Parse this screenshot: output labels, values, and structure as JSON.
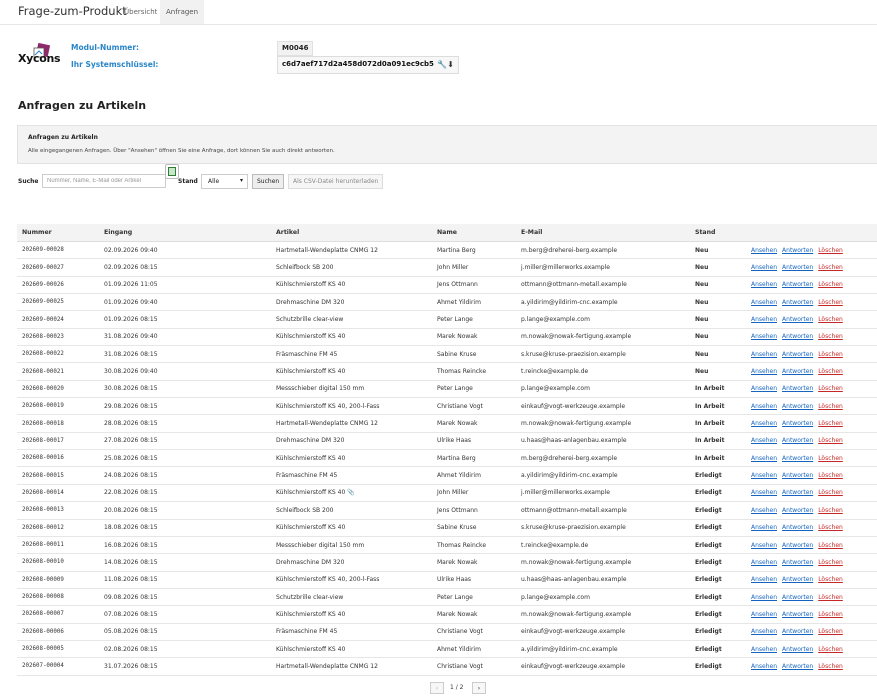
{
  "app": {
    "title": "Frage-zum-Produkt"
  },
  "tabs": [
    {
      "label": "Übersicht"
    },
    {
      "label": "Anfragen"
    }
  ],
  "logo": {
    "text": "Xycons"
  },
  "module": {
    "number_label": "Modul-Nummer:",
    "number_value": "M0046",
    "key_label": "Ihr Systemschlüssel:",
    "key_value": "c6d7aef717d2a458d072d0a091ec9cb5"
  },
  "section": {
    "title": "Anfragen zu Artikeln"
  },
  "infobox": {
    "title": "Anfragen zu Artikeln",
    "text": "Alle eingegangenen Anfragen. Über \"Ansehen\" öffnen Sie eine Anfrage, dort können Sie auch direkt antworten."
  },
  "filter": {
    "search_label": "Suche",
    "search_placeholder": "Nummer, Name, E-Mail oder Artikel",
    "status_label": "Stand",
    "status_value": "Alle",
    "search_button": "Suchen",
    "csv_button": "Als CSV-Datei herunterladen"
  },
  "table": {
    "headers": {
      "number": "Nummer",
      "date": "Eingang",
      "article": "Artikel",
      "name": "Name",
      "email": "E-Mail",
      "status": "Stand"
    },
    "actions": {
      "view": "Ansehen",
      "reply": "Antworten",
      "delete": "Löschen"
    },
    "rows": [
      {
        "number": "202609-00028",
        "date": "02.09.2026 09:40",
        "article": "Hartmetall-Wendeplatte CNMG 12",
        "name": "Martina Berg",
        "email": "m.berg@dreherei-berg.example",
        "status": "Neu",
        "status_kind": "neu"
      },
      {
        "number": "202609-00027",
        "date": "02.09.2026 08:15",
        "article": "Schleifbock SB 200",
        "name": "John Miller",
        "email": "j.miller@millerworks.example",
        "status": "Neu",
        "status_kind": "neu"
      },
      {
        "number": "202609-00026",
        "date": "01.09.2026 11:05",
        "article": "Kühlschmierstoff KS 40",
        "name": "Jens Ottmann",
        "email": "ottmann@ottmann-metall.example",
        "status": "Neu",
        "status_kind": "neu"
      },
      {
        "number": "202609-00025",
        "date": "01.09.2026 09:40",
        "article": "Drehmaschine DM 320",
        "name": "Ahmet Yildirim",
        "email": "a.yildirim@yildirim-cnc.example",
        "status": "Neu",
        "status_kind": "neu"
      },
      {
        "number": "202609-00024",
        "date": "01.09.2026 08:15",
        "article": "Schutzbrille clear-view",
        "name": "Peter Lange",
        "email": "p.lange@example.com",
        "status": "Neu",
        "status_kind": "neu"
      },
      {
        "number": "202608-00023",
        "date": "31.08.2026 09:40",
        "article": "Kühlschmierstoff KS 40",
        "name": "Marek Nowak",
        "email": "m.nowak@nowak-fertigung.example",
        "status": "Neu",
        "status_kind": "neu"
      },
      {
        "number": "202608-00022",
        "date": "31.08.2026 08:15",
        "article": "Fräsmaschine FM 45",
        "name": "Sabine Kruse",
        "email": "s.kruse@kruse-praezision.example",
        "status": "Neu",
        "status_kind": "neu"
      },
      {
        "number": "202608-00021",
        "date": "30.08.2026 09:40",
        "article": "Kühlschmierstoff KS 40",
        "name": "Thomas Reincke",
        "email": "t.reincke@example.de",
        "status": "Neu",
        "status_kind": "neu"
      },
      {
        "number": "202608-00020",
        "date": "30.08.2026 08:15",
        "article": "Messschieber digital 150 mm",
        "name": "Peter Lange",
        "email": "p.lange@example.com",
        "status": "In Arbeit",
        "status_kind": "arbeit"
      },
      {
        "number": "202608-00019",
        "date": "29.08.2026 08:15",
        "article": "Kühlschmierstoff KS 40, 200-l-Fass",
        "name": "Christiane Vogt",
        "email": "einkauf@vogt-werkzeuge.example",
        "status": "In Arbeit",
        "status_kind": "arbeit"
      },
      {
        "number": "202608-00018",
        "date": "28.08.2026 08:15",
        "article": "Hartmetall-Wendeplatte CNMG 12",
        "name": "Marek Nowak",
        "email": "m.nowak@nowak-fertigung.example",
        "status": "In Arbeit",
        "status_kind": "arbeit"
      },
      {
        "number": "202608-00017",
        "date": "27.08.2026 08:15",
        "article": "Drehmaschine DM 320",
        "name": "Ulrike Haas",
        "email": "u.haas@haas-anlagenbau.example",
        "status": "In Arbeit",
        "status_kind": "arbeit"
      },
      {
        "number": "202608-00016",
        "date": "25.08.2026 08:15",
        "article": "Kühlschmierstoff KS 40",
        "name": "Martina Berg",
        "email": "m.berg@dreherei-berg.example",
        "status": "In Arbeit",
        "status_kind": "arbeit"
      },
      {
        "number": "202608-00015",
        "date": "24.08.2026 08:15",
        "article": "Fräsmaschine FM 45",
        "name": "Ahmet Yildirim",
        "email": "a.yildirim@yildirim-cnc.example",
        "status": "Erledigt",
        "status_kind": "erledigt"
      },
      {
        "number": "202608-00014",
        "date": "22.08.2026 08:15",
        "article": "Kühlschmierstoff KS 40",
        "name": "John Miller",
        "email": "j.miller@millerworks.example",
        "status": "Erledigt",
        "status_kind": "erledigt",
        "attachment": true
      },
      {
        "number": "202608-00013",
        "date": "20.08.2026 08:15",
        "article": "Schleifbock SB 200",
        "name": "Jens Ottmann",
        "email": "ottmann@ottmann-metall.example",
        "status": "Erledigt",
        "status_kind": "erledigt"
      },
      {
        "number": "202608-00012",
        "date": "18.08.2026 08:15",
        "article": "Kühlschmierstoff KS 40",
        "name": "Sabine Kruse",
        "email": "s.kruse@kruse-praezision.example",
        "status": "Erledigt",
        "status_kind": "erledigt"
      },
      {
        "number": "202608-00011",
        "date": "16.08.2026 08:15",
        "article": "Messschieber digital 150 mm",
        "name": "Thomas Reincke",
        "email": "t.reincke@example.de",
        "status": "Erledigt",
        "status_kind": "erledigt"
      },
      {
        "number": "202608-00010",
        "date": "14.08.2026 08:15",
        "article": "Drehmaschine DM 320",
        "name": "Marek Nowak",
        "email": "m.nowak@nowak-fertigung.example",
        "status": "Erledigt",
        "status_kind": "erledigt"
      },
      {
        "number": "202608-00009",
        "date": "11.08.2026 08:15",
        "article": "Kühlschmierstoff KS 40, 200-l-Fass",
        "name": "Ulrike Haas",
        "email": "u.haas@haas-anlagenbau.example",
        "status": "Erledigt",
        "status_kind": "erledigt"
      },
      {
        "number": "202608-00008",
        "date": "09.08.2026 08:15",
        "article": "Schutzbrille clear-view",
        "name": "Peter Lange",
        "email": "p.lange@example.com",
        "status": "Erledigt",
        "status_kind": "erledigt"
      },
      {
        "number": "202608-00007",
        "date": "07.08.2026 08:15",
        "article": "Kühlschmierstoff KS 40",
        "name": "Marek Nowak",
        "email": "m.nowak@nowak-fertigung.example",
        "status": "Erledigt",
        "status_kind": "erledigt"
      },
      {
        "number": "202608-00006",
        "date": "05.08.2026 08:15",
        "article": "Fräsmaschine FM 45",
        "name": "Christiane Vogt",
        "email": "einkauf@vogt-werkzeuge.example",
        "status": "Erledigt",
        "status_kind": "erledigt"
      },
      {
        "number": "202608-00005",
        "date": "02.08.2026 08:15",
        "article": "Kühlschmierstoff KS 40",
        "name": "Ahmet Yildirim",
        "email": "a.yildirim@yildirim-cnc.example",
        "status": "Erledigt",
        "status_kind": "erledigt"
      },
      {
        "number": "202607-00004",
        "date": "31.07.2026 08:15",
        "article": "Hartmetall-Wendeplatte CNMG 12",
        "name": "Christiane Vogt",
        "email": "einkauf@vogt-werkzeuge.example",
        "status": "Erledigt",
        "status_kind": "erledigt"
      }
    ]
  },
  "pager": {
    "prev": "‹",
    "info": "1 / 2",
    "next": "›"
  },
  "colors": {
    "accent": "#2a86c8",
    "new": "#c62828",
    "in_progress": "#9a6b00",
    "done": "#2e7d32",
    "link": "#1565c0"
  }
}
